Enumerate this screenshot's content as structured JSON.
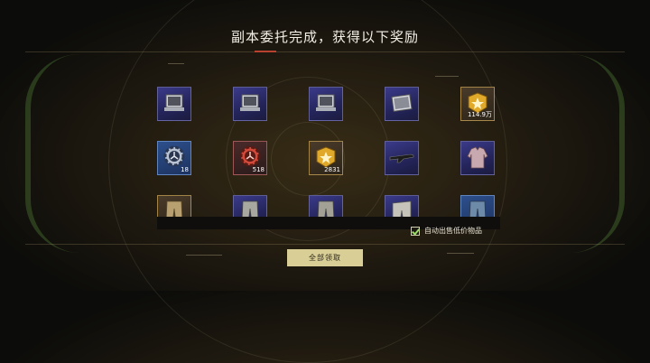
{
  "title": "副本委托完成，获得以下奖励",
  "items": [
    {
      "icon": "laptop-icon",
      "quantity": ""
    },
    {
      "icon": "laptop-icon",
      "quantity": ""
    },
    {
      "icon": "laptop-icon",
      "quantity": ""
    },
    {
      "icon": "laptop-icon",
      "quantity": ""
    },
    {
      "icon": "rank-badge-icon",
      "quantity": "114.9万"
    },
    {
      "icon": "gear-icon",
      "quantity": "18"
    },
    {
      "icon": "gear-icon",
      "quantity": "518"
    },
    {
      "icon": "rank-badge-icon",
      "quantity": "2831"
    },
    {
      "icon": "rifle-icon",
      "quantity": ""
    },
    {
      "icon": "jacket-icon",
      "quantity": ""
    },
    {
      "icon": "pants-icon",
      "quantity": ""
    },
    {
      "icon": "pants-icon",
      "quantity": ""
    },
    {
      "icon": "pants-icon",
      "quantity": ""
    },
    {
      "icon": "pants-icon",
      "quantity": ""
    },
    {
      "icon": "pants-icon",
      "quantity": ""
    }
  ],
  "auto_sell": {
    "checked": true,
    "label": "自动出售低价物品"
  },
  "claim_button": {
    "label": "全部领取"
  }
}
